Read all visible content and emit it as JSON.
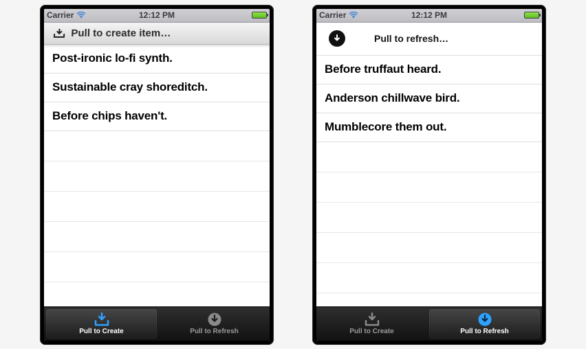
{
  "statusBar": {
    "carrier": "Carrier",
    "time": "12:12 PM"
  },
  "left": {
    "pullHeader": "Pull to create item…",
    "items": [
      "Post-ironic lo-fi synth.",
      "Sustainable cray shoreditch.",
      "Before chips haven't."
    ],
    "activeTab": "create"
  },
  "right": {
    "pullHeader": "Pull to refresh…",
    "items": [
      "Before truffaut heard.",
      "Anderson chillwave bird.",
      "Mumblecore them out."
    ],
    "activeTab": "refresh"
  },
  "tabs": {
    "create": "Pull to Create",
    "refresh": "Pull to Refresh"
  }
}
